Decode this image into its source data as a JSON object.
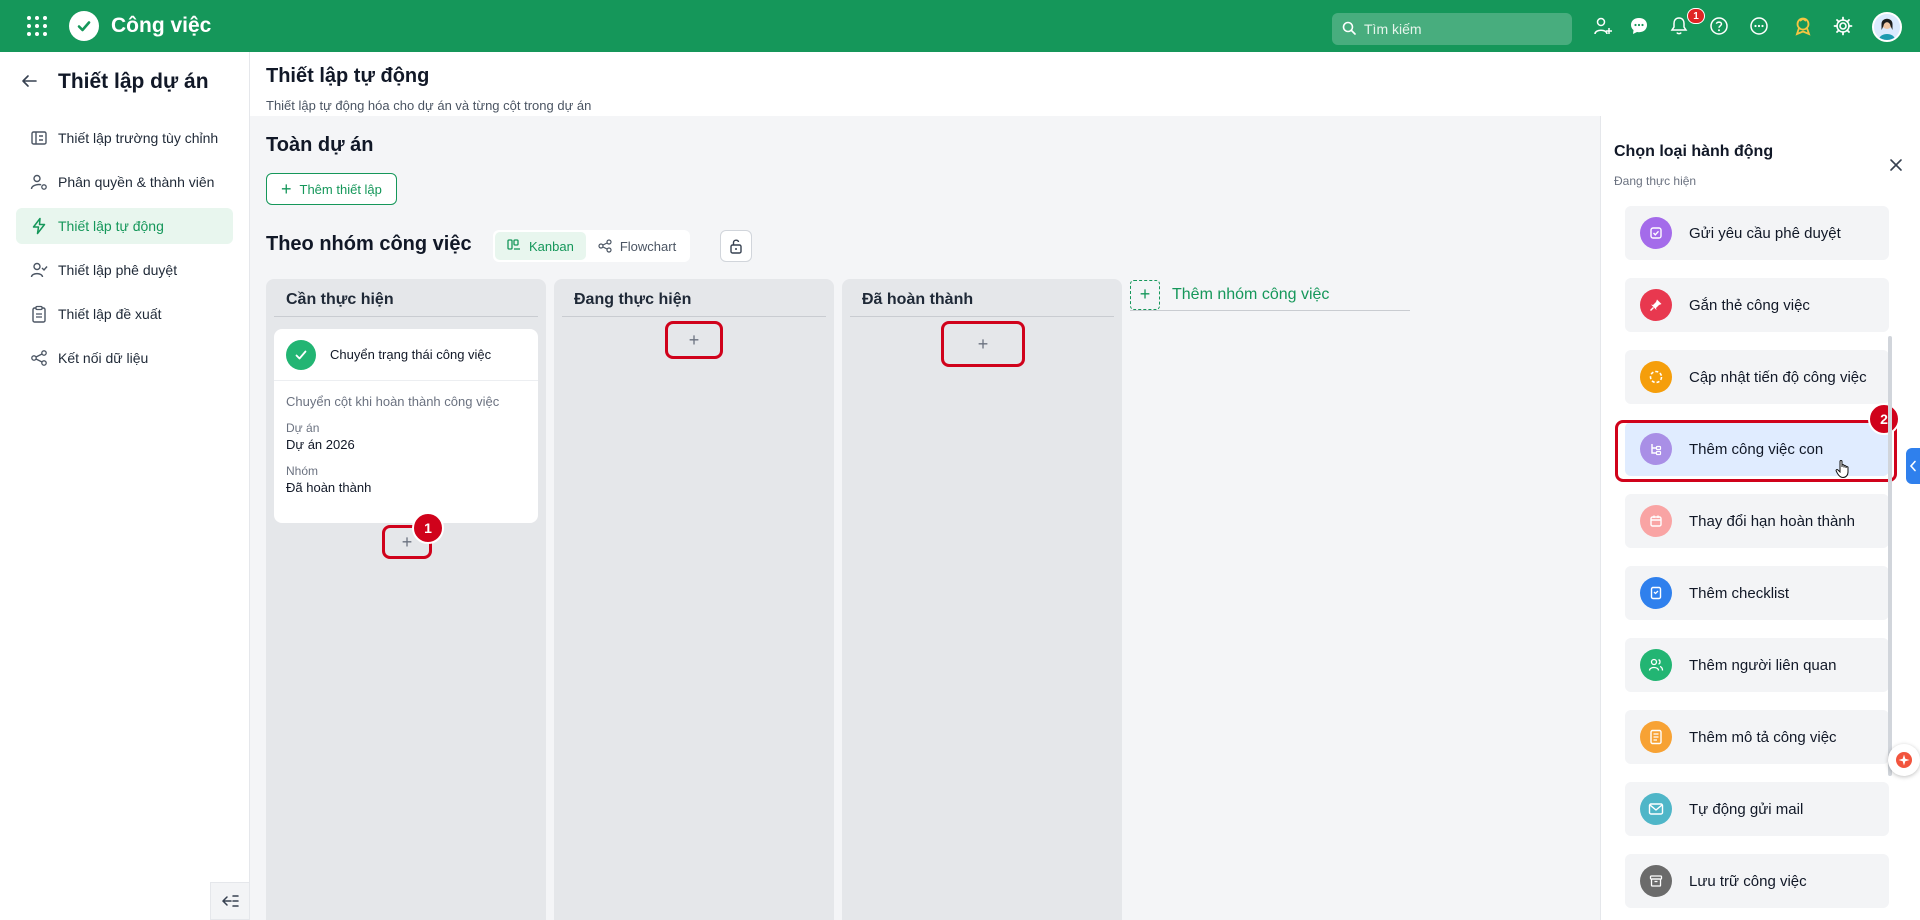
{
  "app": {
    "name": "Công việc"
  },
  "topbar": {
    "search_placeholder": "Tìm kiếm",
    "notification_count": "1"
  },
  "sidebar": {
    "title": "Thiết lập dự án",
    "items": [
      {
        "label": "Thiết lập trường tùy chỉnh",
        "icon": "custom-field-icon"
      },
      {
        "label": "Phân quyền & thành viên",
        "icon": "user-gear-icon"
      },
      {
        "label": "Thiết lập tự động",
        "icon": "lightning-icon",
        "active": true
      },
      {
        "label": "Thiết lập phê duyệt",
        "icon": "user-check-icon"
      },
      {
        "label": "Thiết lập đề xuất",
        "icon": "clipboard-icon"
      },
      {
        "label": "Kết nối dữ liệu",
        "icon": "share-nodes-icon"
      }
    ]
  },
  "main": {
    "title": "Thiết lập tự động",
    "subtitle": "Thiết lập tự động hóa cho dự án và từng cột trong dự án",
    "whole_project": {
      "title": "Toàn dự án",
      "add_label": "Thêm thiết lập"
    },
    "by_group": {
      "title": "Theo nhóm công việc",
      "tabs": [
        {
          "label": "Kanban",
          "active": true
        },
        {
          "label": "Flowchart"
        }
      ]
    },
    "columns": [
      {
        "title": "Cần thực hiện",
        "card": {
          "name": "Chuyển trạng thái công việc",
          "description": "Chuyển cột khi hoàn thành công việc",
          "project_label": "Dự án",
          "project_value": "Dự án 2026",
          "group_label": "Nhóm",
          "group_value": "Đã hoàn thành"
        }
      },
      {
        "title": "Đang thực hiện"
      },
      {
        "title": "Đã hoàn thành"
      }
    ],
    "add_group_label": "Thêm nhóm công việc",
    "steps": [
      "1",
      "2"
    ]
  },
  "panel": {
    "title": "Chọn loại hành động",
    "subtitle": "Đang thực hiện",
    "actions": [
      {
        "label": "Gửi yêu cầu phê duyệt",
        "icon": "approval-check-icon",
        "color": "#a46bea"
      },
      {
        "label": "Gắn thẻ công việc",
        "icon": "pin-icon",
        "color": "#e8384f"
      },
      {
        "label": "Cập nhật tiến độ công việc",
        "icon": "progress-icon",
        "color": "#f59e0b"
      },
      {
        "label": "Thêm công việc con",
        "icon": "subtask-icon",
        "color": "#a98fe6",
        "highlighted": true
      },
      {
        "label": "Thay đổi hạn hoàn thành",
        "icon": "calendar-icon",
        "color": "#f9a4a4"
      },
      {
        "label": "Thêm checklist",
        "icon": "checklist-icon",
        "color": "#2f80ed"
      },
      {
        "label": "Thêm người liên quan",
        "icon": "users-icon",
        "color": "#22b573"
      },
      {
        "label": "Thêm mô tả công việc",
        "icon": "document-icon",
        "color": "#f7a234"
      },
      {
        "label": "Tự động gửi mail",
        "icon": "mail-icon",
        "color": "#4fb6c8"
      },
      {
        "label": "Lưu trữ công việc",
        "icon": "archive-icon",
        "color": "#6b6b6b"
      }
    ]
  }
}
